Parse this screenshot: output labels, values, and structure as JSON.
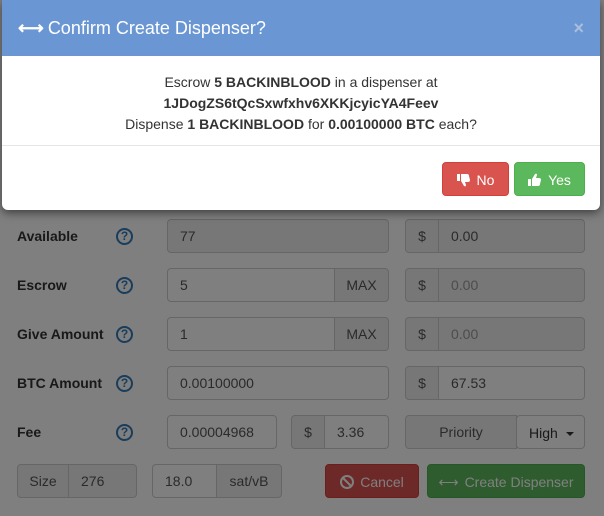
{
  "form": {
    "rows": [
      {
        "label": "Available",
        "value": "77",
        "usd": "0.00",
        "max": ""
      },
      {
        "label": "Escrow",
        "value": "5",
        "usd": "0.00",
        "max": "MAX"
      },
      {
        "label": "Give Amount",
        "value": "1",
        "usd": "0.00",
        "max": "MAX"
      },
      {
        "label": "BTC Amount",
        "value": "0.00100000",
        "usd": "67.53",
        "max": ""
      }
    ],
    "fee": {
      "label": "Fee",
      "value": "0.00004968",
      "usd": "3.36",
      "priority_label": "Priority",
      "priority_value": "High"
    },
    "size": {
      "label": "Size",
      "value": "276",
      "rate": "18.0",
      "unit": "sat/vB"
    },
    "currency_symbol": "$",
    "help_glyph": "?",
    "cancel_label": "Cancel",
    "create_label": "Create Dispenser"
  },
  "modal": {
    "title": "Confirm Create Dispenser?",
    "close": "×",
    "line1_pre": "Escrow ",
    "line1_bold": "5 BACKINBLOOD",
    "line1_post": " in a dispenser at",
    "address": "1JDogZS6tQcSxwfxhv6XKKjcyicYA4Feev",
    "line3_pre": "Dispense ",
    "line3_bold1": "1 BACKINBLOOD",
    "line3_mid": " for ",
    "line3_bold2": "0.00100000 BTC",
    "line3_post": " each?",
    "no_label": "No",
    "yes_label": "Yes"
  },
  "colors": {
    "header": "#6a97d3",
    "danger": "#d9534f",
    "success": "#5cb85c",
    "help": "#337ab7"
  },
  "icons": {
    "title_icon": "arrows-h-icon",
    "help_icon": "question-circle-icon",
    "no_icon": "thumbs-down-icon",
    "yes_icon": "thumbs-up-icon",
    "cancel_icon": "ban-icon",
    "create_icon": "arrows-h-icon",
    "caret_icon": "caret-down-icon"
  }
}
